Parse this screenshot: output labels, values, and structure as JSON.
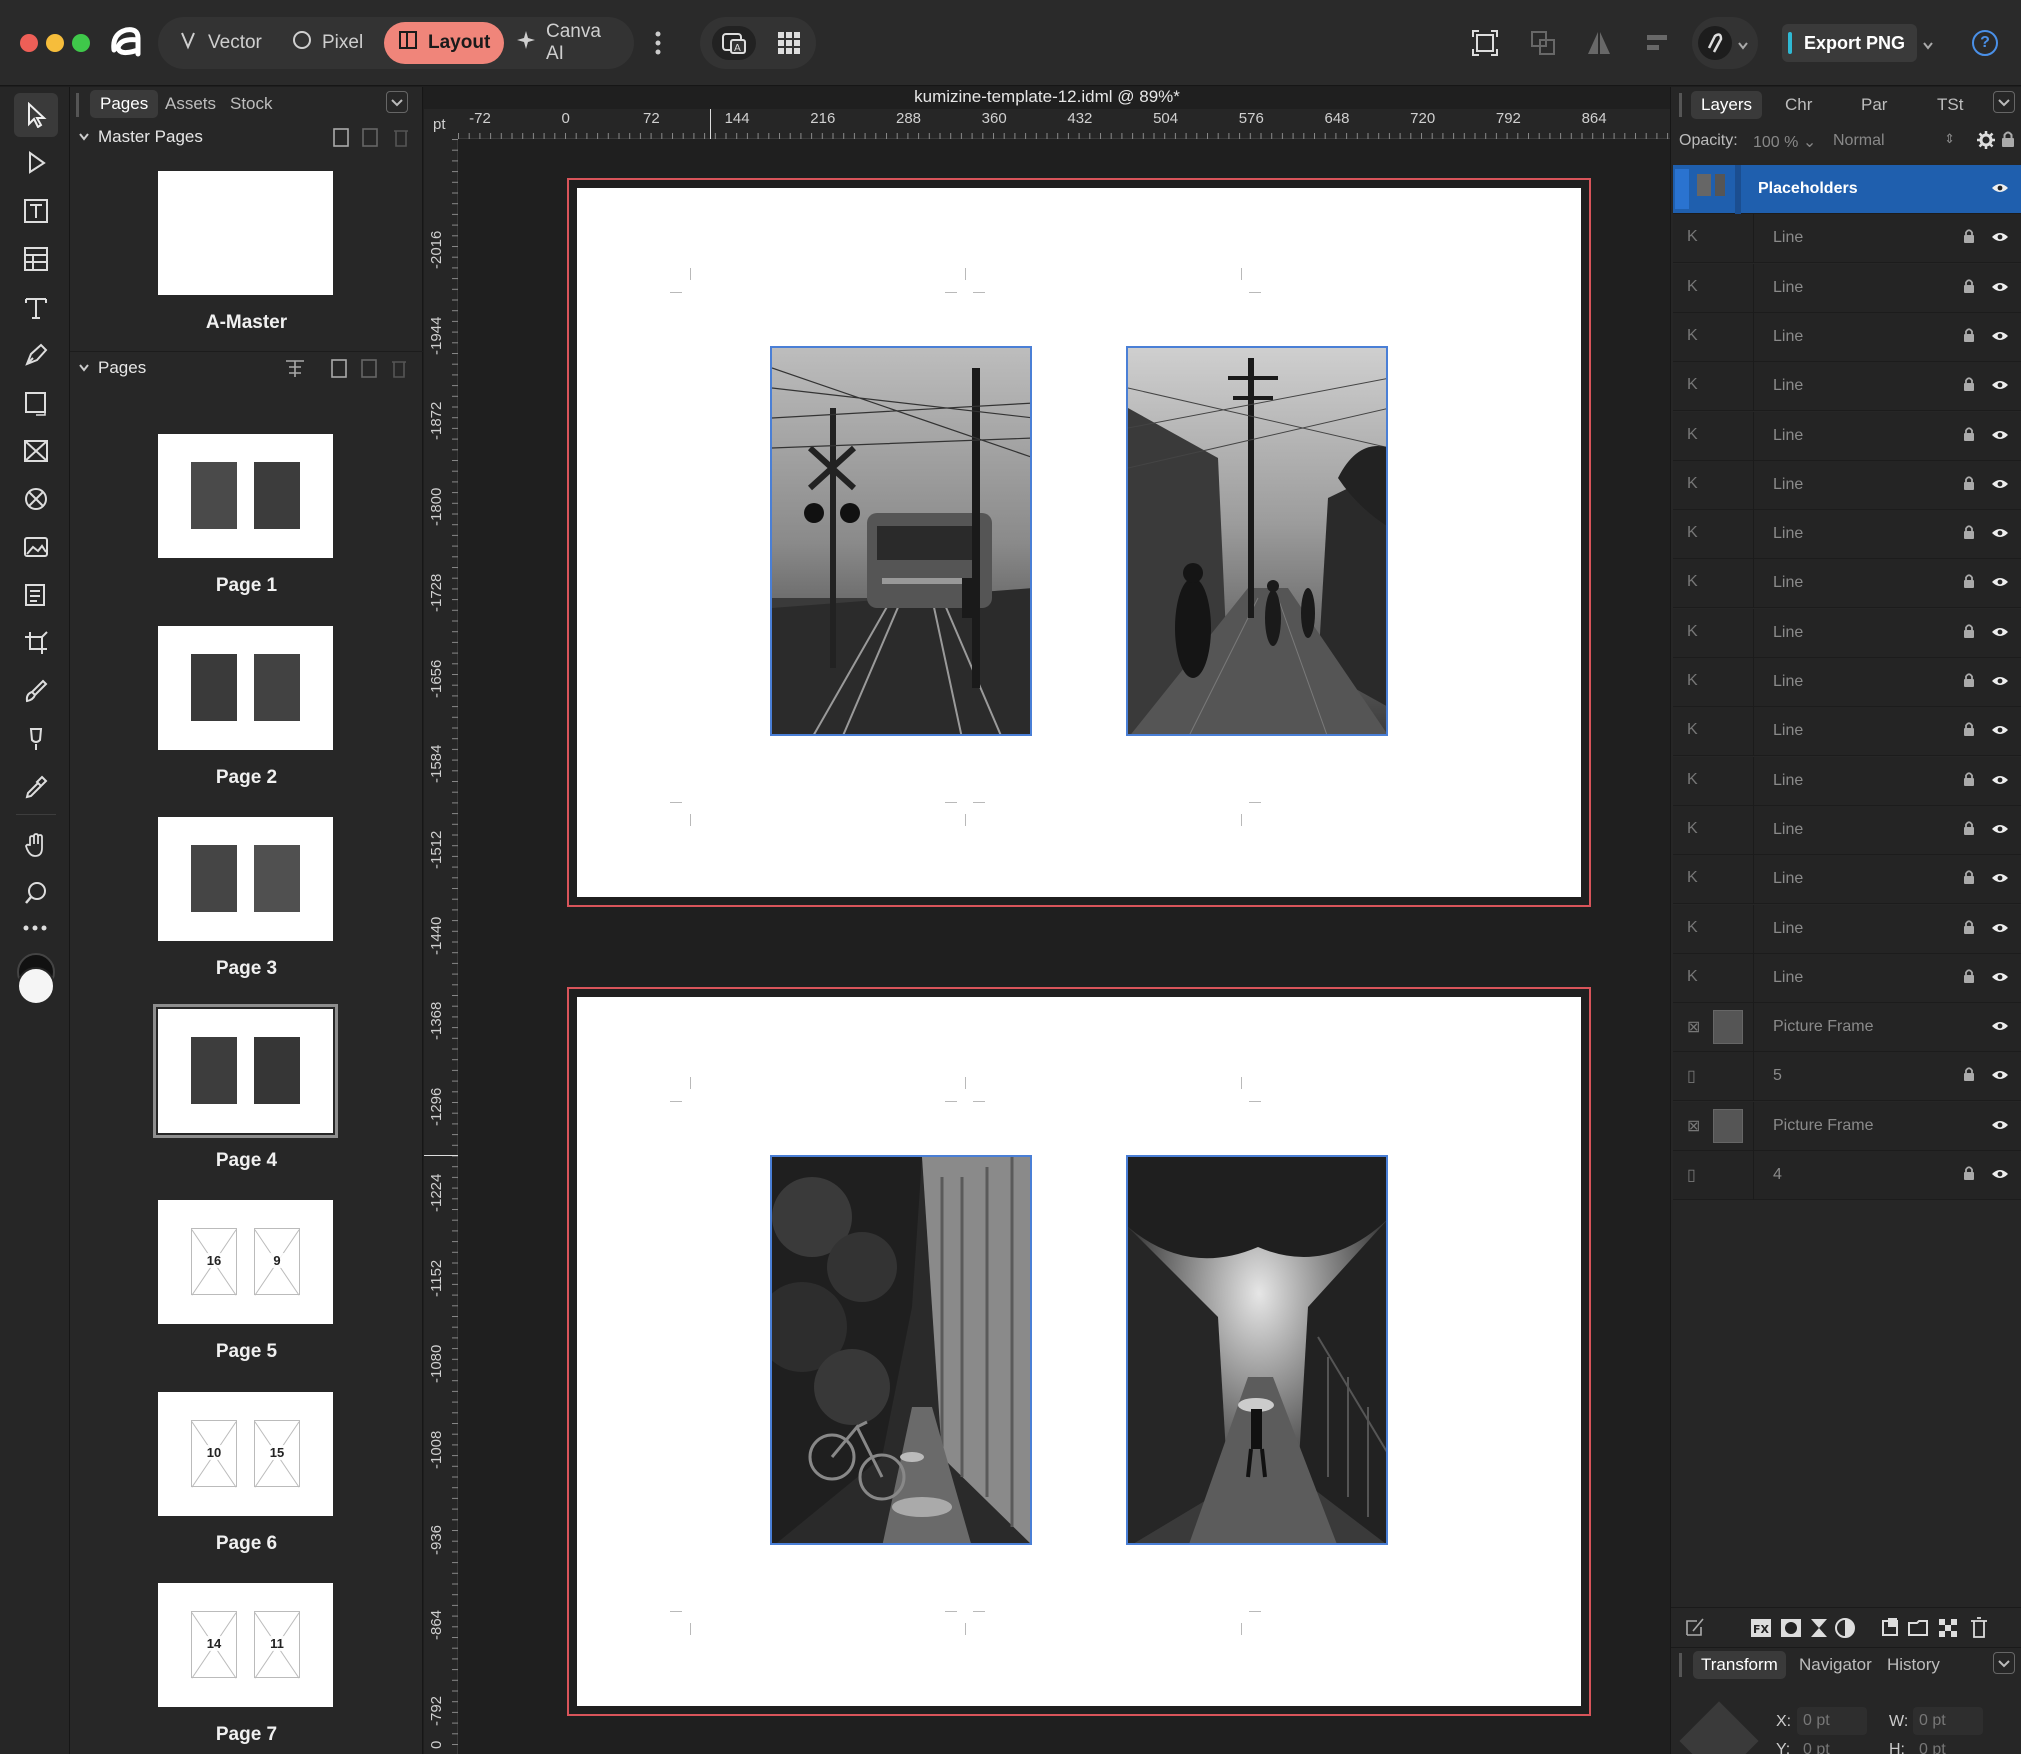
{
  "app": {
    "personas": [
      {
        "label": "Vector",
        "icon": "vector-persona-icon"
      },
      {
        "label": "Pixel",
        "icon": "pixel-persona-icon"
      },
      {
        "label": "Layout",
        "icon": "layout-persona-icon",
        "active": true
      },
      {
        "label": "Canva AI",
        "icon": "sparkle-icon"
      }
    ],
    "export_label": "Export PNG",
    "help_label": "?"
  },
  "pages_panel": {
    "tabs": [
      "Pages",
      "Assets",
      "Stock"
    ],
    "master_header": "Master Pages",
    "master_name": "A-Master",
    "pages_header": "Pages",
    "pages": [
      {
        "label": "Page 1",
        "left": "",
        "right": ""
      },
      {
        "label": "Page 2",
        "left": "",
        "right": ""
      },
      {
        "label": "Page 3",
        "left": "",
        "right": ""
      },
      {
        "label": "Page 4",
        "left": "",
        "right": "",
        "selected": true
      },
      {
        "label": "Page 5",
        "left": "16",
        "right": "9"
      },
      {
        "label": "Page 6",
        "left": "10",
        "right": "15"
      },
      {
        "label": "Page 7",
        "left": "14",
        "right": "11"
      }
    ]
  },
  "document": {
    "title": "kumizine-template-12.idml @ 89%*",
    "unit": "pt",
    "h_ruler": [
      "-72",
      "0",
      "72",
      "144",
      "216",
      "288",
      "360",
      "432",
      "504",
      "576",
      "648",
      "720",
      "792",
      "864"
    ],
    "v_ruler": [
      "-2016",
      "-1944",
      "-1872",
      "-1800",
      "-1728",
      "-1656",
      "-1584",
      "-1512",
      "-1440",
      "-1368",
      "-1296",
      "-1224",
      "-1152",
      "-1080",
      "-1008",
      "-936",
      "-864",
      "-792",
      "0"
    ]
  },
  "layers_panel": {
    "tabs": [
      "Layers",
      "Chr",
      "Par",
      "TSt"
    ],
    "opacity_label": "Opacity:",
    "opacity_value": "100 %",
    "blend_mode": "Normal",
    "layers": [
      {
        "name": "Placeholders",
        "selected": true
      },
      {
        "name": "Line",
        "lead": "K"
      },
      {
        "name": "Line",
        "lead": "K"
      },
      {
        "name": "Line",
        "lead": "K"
      },
      {
        "name": "Line",
        "lead": "K"
      },
      {
        "name": "Line",
        "lead": "K"
      },
      {
        "name": "Line",
        "lead": "K"
      },
      {
        "name": "Line",
        "lead": "K"
      },
      {
        "name": "Line",
        "lead": "K"
      },
      {
        "name": "Line",
        "lead": "K"
      },
      {
        "name": "Line",
        "lead": "K"
      },
      {
        "name": "Line",
        "lead": "K"
      },
      {
        "name": "Line",
        "lead": "K"
      },
      {
        "name": "Line",
        "lead": "K"
      },
      {
        "name": "Line",
        "lead": "K"
      },
      {
        "name": "Line",
        "lead": "K"
      },
      {
        "name": "Line",
        "lead": "K"
      },
      {
        "name": "Picture Frame",
        "lead": "⊠",
        "thumb": true,
        "nolock": true
      },
      {
        "name": "5",
        "lead": "▯"
      },
      {
        "name": "Picture Frame",
        "lead": "⊠",
        "thumb": true,
        "nolock": true
      },
      {
        "name": "4",
        "lead": "▯"
      }
    ],
    "bottom_tabs": [
      "Transform",
      "Navigator",
      "History"
    ],
    "transform": {
      "x_label": "X:",
      "x_value": "0 pt",
      "w_label": "W:",
      "w_value": "0 pt",
      "y_label": "Y:",
      "y_value": "0 pt",
      "h_label": "H:",
      "h_value": "0 pt"
    }
  },
  "colors": {
    "accent": "#f0857a",
    "selection": "#1f5fae",
    "bleed": "#d8545a",
    "frame": "#4a7fd6"
  }
}
